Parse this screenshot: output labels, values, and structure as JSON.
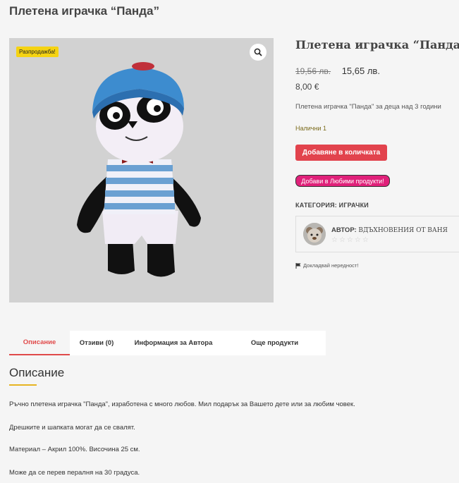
{
  "page_title": "Плетена играчка “Панда”",
  "gallery": {
    "sale_badge": "Разпродажба!",
    "zoom_icon": "magnifier-icon"
  },
  "product": {
    "title": "Плетена играчка “Панда”",
    "old_price": "19,56 лв.",
    "new_price": "15,65 лв.",
    "euro_price": "8,00 €",
    "short_description": "Плетена играчка \"Панда\" за деца над 3 години",
    "stock": "Налични 1",
    "add_to_cart_label": "Добавяне в количката",
    "favorite_label": "Добави в Любими продукти!",
    "category_label": "КАТЕГОРИЯ:",
    "category_value": "ИГРАЧКИ",
    "author_label": "АВТОР:",
    "author_value": "ВДЪХНОВЕНИЯ ОТ ВАНЯ",
    "author_stars": "☆☆☆☆☆",
    "report_label": "Докладвай нередност!"
  },
  "tabs": [
    {
      "label": "Описание",
      "active": true
    },
    {
      "label": "Отзиви (0)",
      "active": false
    },
    {
      "label": "Информация за Автора",
      "active": false
    },
    {
      "label": "Още продукти",
      "active": false
    }
  ],
  "description": {
    "heading": "Описание",
    "paragraphs": [
      "Ръчно плетена играчка \"Панда\", изработена с много любов. Мил подарък за Вашето дете или за любим човек.",
      "Дрешките и шапката могат да се свалят.",
      "Материал – Акрил 100%. Височина 25 см.",
      "Може да се перев пералня на 30 градуса."
    ]
  },
  "colors": {
    "accent_red": "#e2434d",
    "favorite_pink": "#e0217a",
    "sale_yellow": "#f5d312",
    "underline_gold": "#e6b422"
  }
}
